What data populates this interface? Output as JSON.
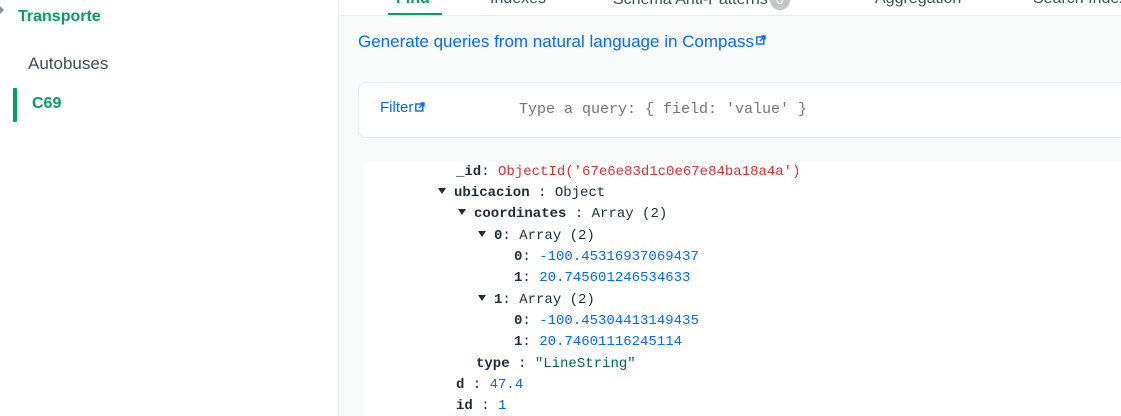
{
  "sidebar": {
    "database": "Transporte",
    "collections": [
      {
        "name": "Autobuses"
      },
      {
        "name": "C69"
      }
    ]
  },
  "tabs": [
    {
      "label": "Find"
    },
    {
      "label": "Indexes"
    },
    {
      "label": "Schema Anti-Patterns",
      "badge": "0"
    },
    {
      "label": "Aggregation"
    },
    {
      "label": "Search Indexes"
    }
  ],
  "nl_link": "Generate queries from natural language in Compass",
  "filter": {
    "label": "Filter",
    "placeholder": "Type a query: { field: 'value' }"
  },
  "document": {
    "id_key": "_id",
    "id_value": "ObjectId('67e6e83d1c0e67e84ba18a4a')",
    "ubicacion_key": "ubicacion",
    "ubicacion_type": "Object",
    "coordinates_key": "coordinates",
    "coordinates_type": "Array (2)",
    "c0_key": "0",
    "c0_type": "Array (2)",
    "c0_v0_key": "0",
    "c0_v0": "-100.45316937069437",
    "c0_v1_key": "1",
    "c0_v1": "20.745601246534633",
    "c1_key": "1",
    "c1_type": "Array (2)",
    "c1_v0_key": "0",
    "c1_v0": "-100.45304413149435",
    "c1_v1_key": "1",
    "c1_v1": "20.74601116245114",
    "type_key": "type",
    "type_value": "\"LineString\"",
    "d_key": "d",
    "d_value": "47.4",
    "id2_key": "id",
    "id2_value": "1"
  },
  "colors": {
    "accent_green": "#00a35c",
    "link_blue": "#016bf8",
    "objectid_red": "#db3030",
    "string_green": "#00684a"
  },
  "icons": [
    "external-link-icon",
    "expand-caret-icon"
  ]
}
